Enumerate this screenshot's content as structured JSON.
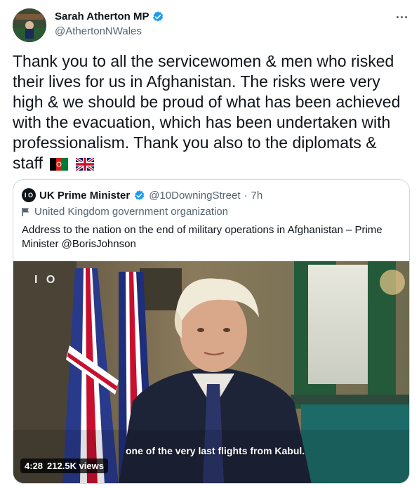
{
  "author": {
    "name": "Sarah Atherton MP",
    "handle": "@AthertonNWales",
    "verified": true
  },
  "tweet": {
    "text": "Thank you to all the servicewomen & men who risked their lives for us in Afghanistan. The risks were very high & we should be proud of what has been achieved with the evacuation, which has been undertaken with professionalism. Thank you also to the diplomats & staff",
    "emoji": [
      "flag-afghanistan",
      "flag-united-kingdom"
    ]
  },
  "quoted": {
    "name": "UK Prime Minister",
    "logo": "I O",
    "handle": "@10DowningStreet",
    "separator": "·",
    "time": "7h",
    "org_label": "United Kingdom government organization",
    "text": "Address to the nation on the end of military operations in Afghanistan – Prime Minister @BorisJohnson",
    "video": {
      "watermark": "I O",
      "caption": "one of the very last flights from Kabul.",
      "duration": "4:28",
      "views": "212.5K views"
    }
  },
  "colors": {
    "text": "#0f1419",
    "secondary": "#536471",
    "verified": "#1d9bf0",
    "border": "#cfd9de"
  }
}
